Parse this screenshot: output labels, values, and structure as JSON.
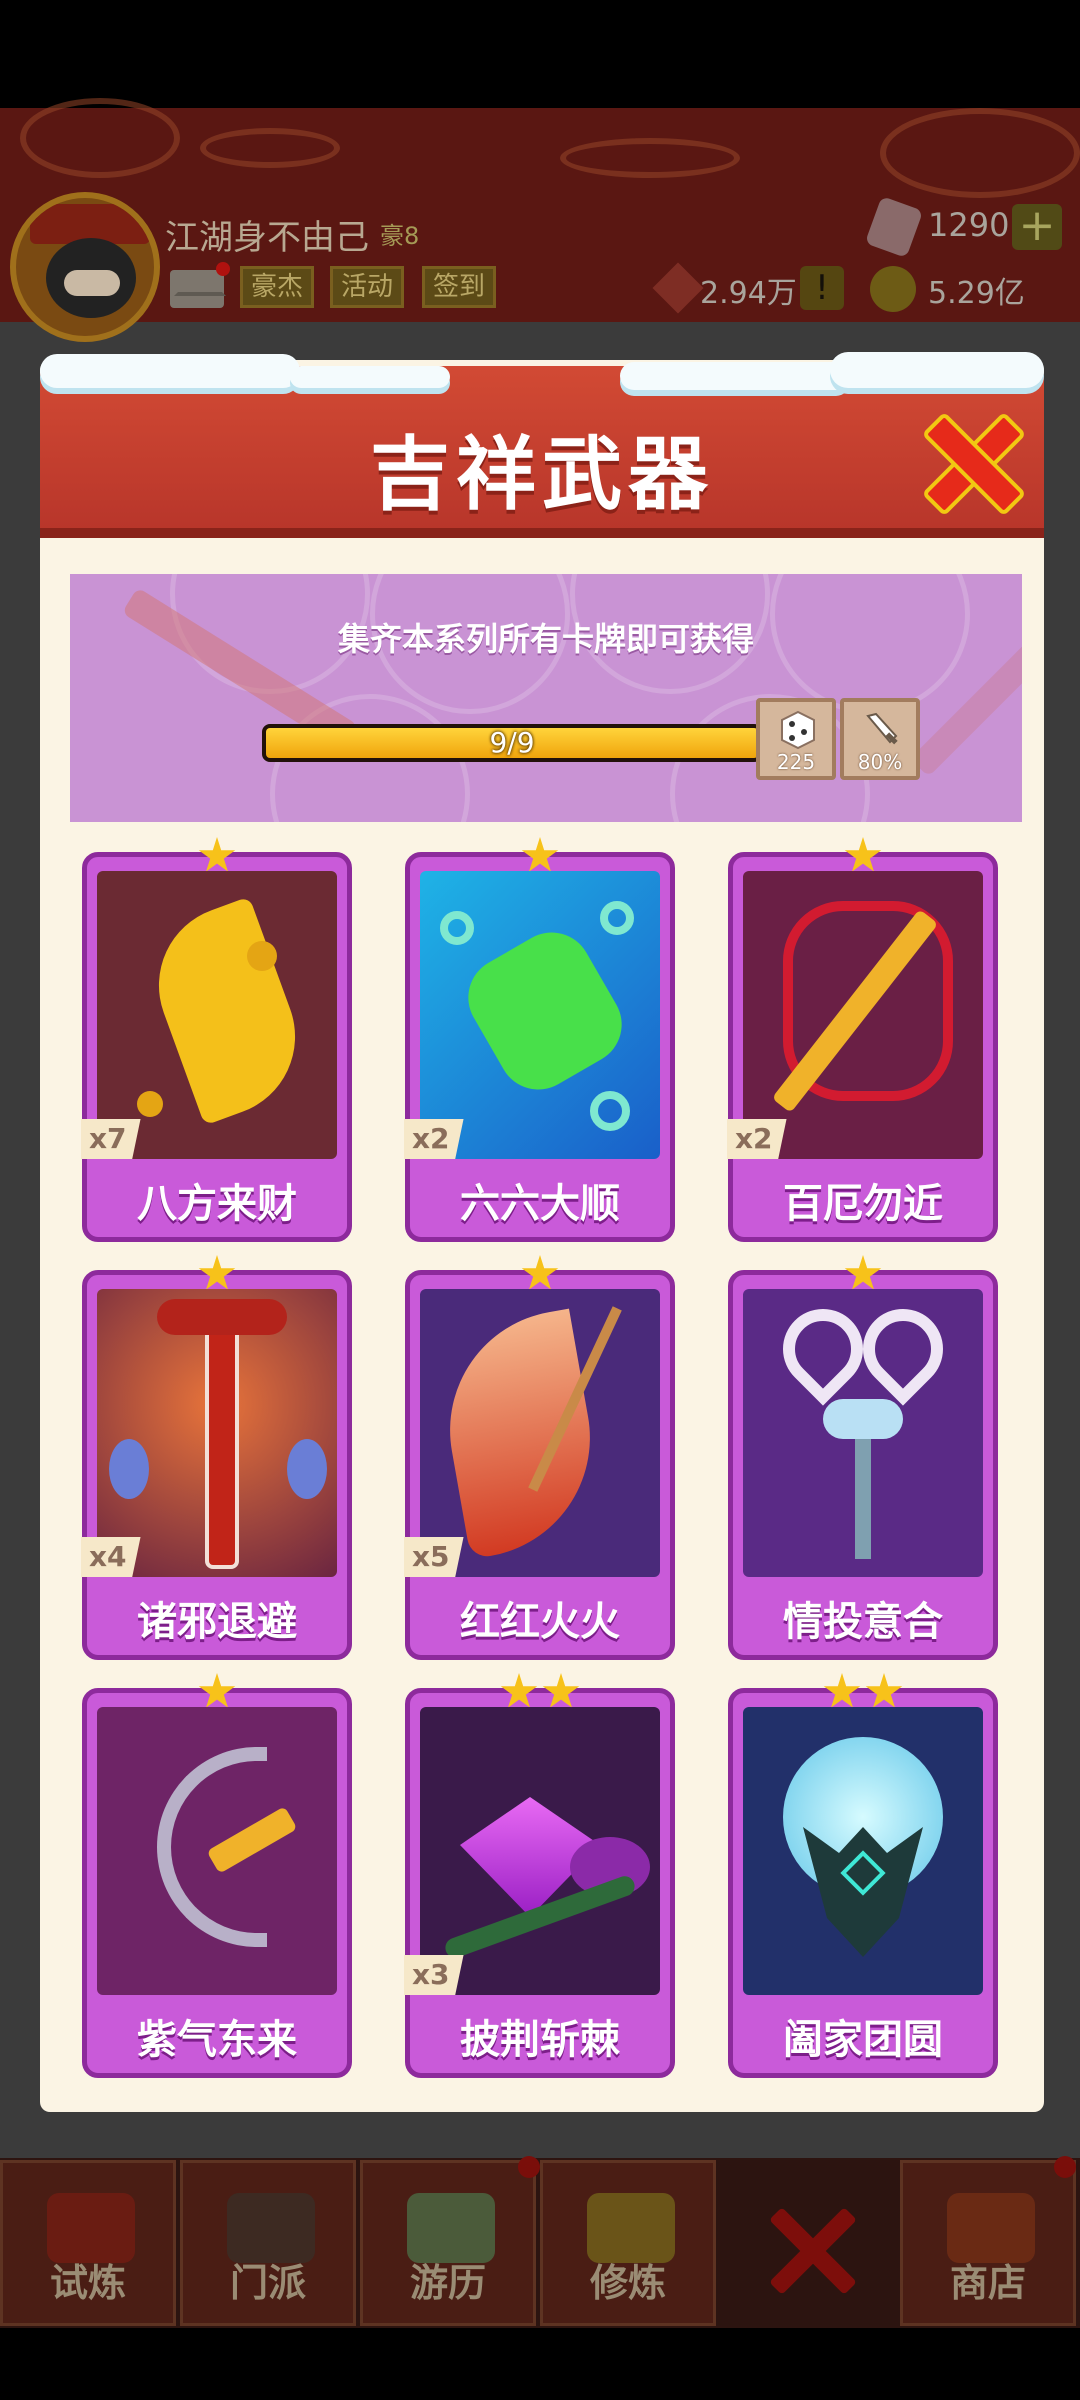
{
  "header": {
    "player_name": "江湖身不由己",
    "player_rank": "豪8",
    "buttons": [
      "豪杰",
      "活动",
      "签到"
    ],
    "gems": "1290",
    "plus": "+",
    "currency_a": "2.94万",
    "warn": "!",
    "currency_b": "5.29亿"
  },
  "modal": {
    "title": "吉祥武器",
    "banner_text": "集齐本系列所有卡牌即可获得",
    "progress": {
      "text": "9/9",
      "current": 9,
      "total": 9
    },
    "rewards": [
      {
        "icon": "dice-icon",
        "value": "225"
      },
      {
        "icon": "sword-icon",
        "value": "80%"
      }
    ],
    "cards": [
      {
        "name": "八方来财",
        "count": "x7",
        "stars": 1
      },
      {
        "name": "六六大顺",
        "count": "x2",
        "stars": 1
      },
      {
        "name": "百厄勿近",
        "count": "x2",
        "stars": 1
      },
      {
        "name": "诸邪退避",
        "count": "x4",
        "stars": 1
      },
      {
        "name": "红红火火",
        "count": "x5",
        "stars": 1
      },
      {
        "name": "情投意合",
        "count": "",
        "stars": 1
      },
      {
        "name": "紫气东来",
        "count": "",
        "stars": 1
      },
      {
        "name": "披荆斩棘",
        "count": "x3",
        "stars": 2
      },
      {
        "name": "阖家团圆",
        "count": "",
        "stars": 2
      }
    ]
  },
  "nav": {
    "tabs": [
      "试炼",
      "门派",
      "游历",
      "修炼",
      "商店"
    ]
  },
  "colors": {
    "card_purple": "#c95ad9",
    "header_red": "#c43f2f",
    "progress_yellow": "#f7c21a"
  }
}
